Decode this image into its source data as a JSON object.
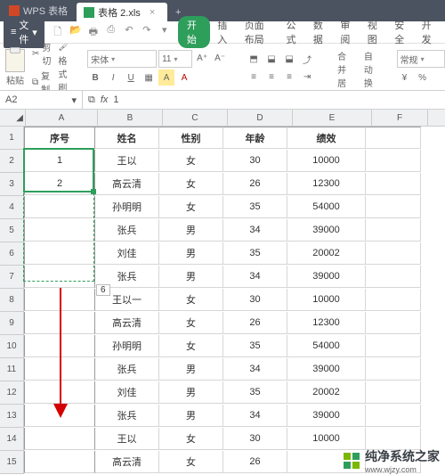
{
  "titlebar": {
    "home_label": "WPS 表格",
    "file_label": "表格 2.xls",
    "close_glyph": "×",
    "add_glyph": "+"
  },
  "menubar": {
    "menu_label": "文件",
    "drop_glyph": "▾",
    "icons": [
      "🗋",
      "📂",
      "🖶",
      "⎙",
      "↶",
      "↷"
    ],
    "active_tab": "开始",
    "tabs": [
      "插入",
      "页面布局",
      "公式",
      "数据",
      "审阅",
      "视图",
      "安全",
      "开发"
    ]
  },
  "ribbon": {
    "paste_label": "粘贴",
    "cut_label": "剪切",
    "copy_label": "复制",
    "format_painter_label": "格式刷",
    "font_name": "宋体",
    "font_size": "11",
    "bold": "B",
    "italic": "I",
    "underline": "U",
    "cell_border_glyph": "▦",
    "font_inc": "A⁺",
    "font_dec": "A⁻",
    "font_aa": "A",
    "font_color": "A",
    "align_left": "≡",
    "align_center": "≡",
    "align_right": "≡",
    "wrap_label": "自动换行",
    "merge_label": "合并居中",
    "number_format": "常规",
    "currency": "¥",
    "percent": "%"
  },
  "refbar": {
    "cell_name": "A2",
    "drop_glyph": "▾",
    "link_glyph": "⧉",
    "fx_label": "fx",
    "formula_value": "1"
  },
  "columns": [
    "A",
    "B",
    "C",
    "D",
    "E",
    "F"
  ],
  "header_row": {
    "A": "序号",
    "B": "姓名",
    "C": "性别",
    "D": "年龄",
    "E": "绩效"
  },
  "rows": [
    {
      "n": 1,
      "A": "序号",
      "B": "姓名",
      "C": "性别",
      "D": "年龄",
      "E": "绩效"
    },
    {
      "n": 2,
      "A": "1",
      "B": "王以",
      "C": "女",
      "D": "30",
      "E": "10000"
    },
    {
      "n": 3,
      "A": "2",
      "B": "高云清",
      "C": "女",
      "D": "26",
      "E": "12300"
    },
    {
      "n": 4,
      "A": "",
      "B": "孙明明",
      "C": "女",
      "D": "35",
      "E": "54000"
    },
    {
      "n": 5,
      "A": "",
      "B": "张兵",
      "C": "男",
      "D": "34",
      "E": "39000"
    },
    {
      "n": 6,
      "A": "",
      "B": "刘佳",
      "C": "男",
      "D": "35",
      "E": "20002"
    },
    {
      "n": 7,
      "A": "",
      "B": "张兵",
      "C": "男",
      "D": "34",
      "E": "39000"
    },
    {
      "n": 8,
      "A": "",
      "B": "王以一",
      "C": "女",
      "D": "30",
      "E": "10000"
    },
    {
      "n": 9,
      "A": "",
      "B": "高云清",
      "C": "女",
      "D": "26",
      "E": "12300"
    },
    {
      "n": 10,
      "A": "",
      "B": "孙明明",
      "C": "女",
      "D": "35",
      "E": "54000"
    },
    {
      "n": 11,
      "A": "",
      "B": "张兵",
      "C": "男",
      "D": "34",
      "E": "39000"
    },
    {
      "n": 12,
      "A": "",
      "B": "刘佳",
      "C": "男",
      "D": "35",
      "E": "20002"
    },
    {
      "n": 13,
      "A": "",
      "B": "张兵",
      "C": "男",
      "D": "34",
      "E": "39000"
    },
    {
      "n": 14,
      "A": "",
      "B": "王以",
      "C": "女",
      "D": "30",
      "E": "10000"
    },
    {
      "n": 15,
      "A": "",
      "B": "高云清",
      "C": "女",
      "D": "26",
      "E": ""
    }
  ],
  "fill_tooltip": "6",
  "watermark": {
    "name": "纯净系统之家",
    "url": "www.wjzy.com"
  },
  "colors": {
    "accent": "#2e9e5b",
    "titlebar": "#4b5260"
  }
}
